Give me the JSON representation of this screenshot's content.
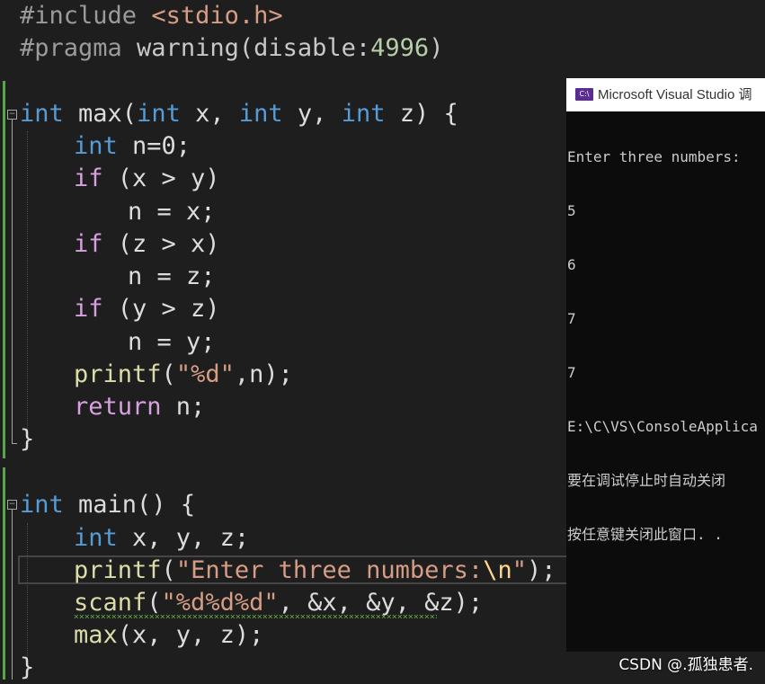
{
  "code": {
    "l1": [
      "#include ",
      "<stdio.h>"
    ],
    "l2": [
      "#pragma ",
      "warning",
      "(disable:",
      "4996",
      ")"
    ],
    "l4": [
      "int",
      " max(",
      "int",
      " x, ",
      "int",
      " y, ",
      "int",
      " z) {"
    ],
    "l5": [
      "int",
      " n=0;"
    ],
    "l6": [
      "if",
      " (x > y)"
    ],
    "l7": "n = x;",
    "l8": [
      "if",
      " (z > x)"
    ],
    "l9": "n = z;",
    "l10": [
      "if",
      " (y > z)"
    ],
    "l11": "n = y;",
    "l12": [
      "printf",
      "(",
      "\"%d\"",
      ",n);"
    ],
    "l13": [
      "return",
      " n;"
    ],
    "l14": "}",
    "l16": [
      "int",
      " main() {"
    ],
    "l17": [
      "int",
      " x, y, z;"
    ],
    "l18": [
      "printf",
      "(",
      "\"Enter three numbers:",
      "\\n",
      "\"",
      ");"
    ],
    "l19": [
      "scanf",
      "(",
      "\"%d%d%d\"",
      ", &x, &y, &z",
      ");"
    ],
    "l20": [
      "max",
      "(x, y, z);"
    ],
    "l21": "}"
  },
  "console": {
    "title": "Microsoft Visual Studio 调",
    "icon_label": "C:\\",
    "lines": [
      "Enter three numbers:",
      "5",
      "6",
      "7",
      "7",
      "E:\\C\\VS\\ConsoleApplica",
      "要在调试停止时自动关闭",
      "按任意键关闭此窗口. ."
    ]
  },
  "watermark": "CSDN @.孤独患者.",
  "colors": {
    "background": "#1e1e1e",
    "keyword": "#569cd6",
    "control": "#d8a0df",
    "function": "#dcdcaa",
    "string": "#d69d85",
    "console_bg": "#0c0c0c"
  }
}
